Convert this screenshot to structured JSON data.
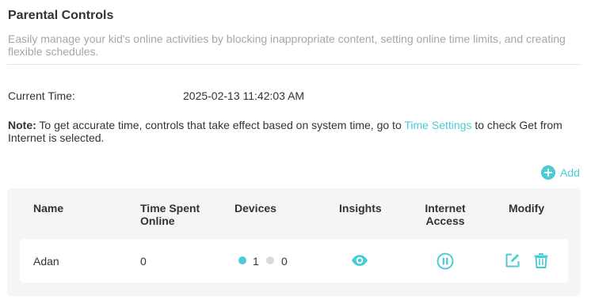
{
  "header": {
    "title": "Parental Controls",
    "description": "Easily manage your kid's online activities by blocking inappropriate content, setting online time limits, and creating flexible schedules."
  },
  "current_time": {
    "label": "Current Time:",
    "value": "2025-02-13 11:42:03 AM"
  },
  "note": {
    "prefix": "Note:",
    "text_before": " To get accurate time, controls that take effect based on system time, go to ",
    "link": "Time Settings",
    "text_after": " to check Get from Internet is selected."
  },
  "add_button": {
    "label": "Add",
    "icon": "plus-circle-icon"
  },
  "table": {
    "columns": [
      "Name",
      "Time Spent Online",
      "Devices",
      "Insights",
      "Internet Access",
      "Modify"
    ],
    "column_lines": {
      "time_spent_line1": "Time Spent",
      "time_spent_line2": "Online",
      "internet_line1": "Internet",
      "internet_line2": "Access"
    },
    "rows": [
      {
        "name": "Adan",
        "time_spent": "0",
        "devices_online": "1",
        "devices_offline": "0",
        "insights_icon": "eye-icon",
        "internet_icon": "pause-icon",
        "modify_icons": [
          "edit-icon",
          "trash-icon"
        ]
      }
    ]
  },
  "colors": {
    "accent": "#4acbd6",
    "online_dot": "#4acbd6",
    "offline_dot": "#d9d9d9",
    "table_bg": "#f4f5f7"
  }
}
